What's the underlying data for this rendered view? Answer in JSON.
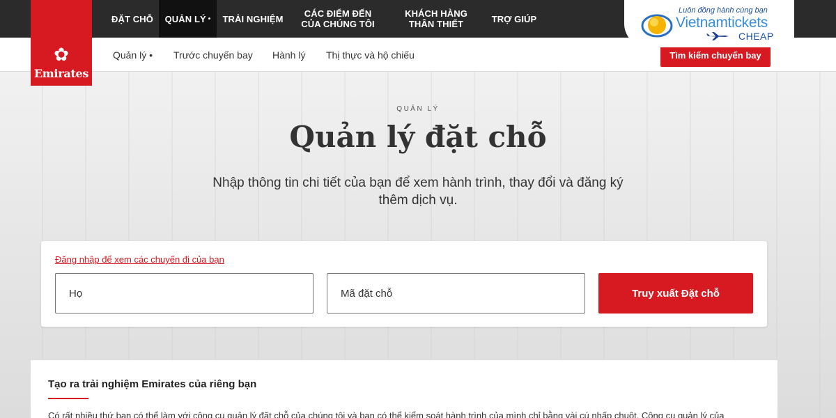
{
  "brand": {
    "logo_text": "Emirates",
    "accent_color": "#d71921",
    "nav_bg": "#2b2b2b"
  },
  "topnav": {
    "items": [
      {
        "label": "ĐẶT CHỖ"
      },
      {
        "label": "QUẢN LÝ"
      },
      {
        "label": "TRẢI NGHIỆM"
      },
      {
        "label_line1": "CÁC ĐIỂM ĐẾN",
        "label_line2": "CỦA CHÚNG TÔI"
      },
      {
        "label_line1": "KHÁCH HÀNG",
        "label_line2": "THÂN THIẾT"
      },
      {
        "label": "TRỢ GIÚP"
      }
    ],
    "active_dot": "•"
  },
  "subnav": {
    "items": [
      {
        "label": "Quản lý •"
      },
      {
        "label": "Trước chuyến bay"
      },
      {
        "label": "Hành lý"
      },
      {
        "label": "Thị thực và hộ chiếu"
      }
    ],
    "search_button": "Tìm kiếm chuyến bay"
  },
  "watermark": {
    "tagline": "Luôn đồng hành cùng bạn",
    "name": "Vietnamtickets",
    "sub": "CHEAP"
  },
  "hero": {
    "eyebrow": "QUẢN LÝ",
    "title": "Quản lý đặt chỗ",
    "subtitle": "Nhập thông tin chi tiết của bạn để xem hành trình, thay đổi và đăng ký thêm dịch vụ."
  },
  "form": {
    "login_link": "Đăng nhập để xem các chuyến đi của bạn",
    "last_name_placeholder": "Họ",
    "booking_ref_placeholder": "Mã đặt chỗ",
    "submit": "Truy xuất Đặt chỗ"
  },
  "info": {
    "title": "Tạo ra trải nghiệm Emirates của riêng bạn",
    "text": "Có rất nhiều thứ bạn có thể làm với công cụ quản lý đặt chỗ của chúng tôi và bạn có thể kiểm soát hành trình của mình chỉ bằng vài cú nhấp chuột. Công cụ quản lý của"
  }
}
